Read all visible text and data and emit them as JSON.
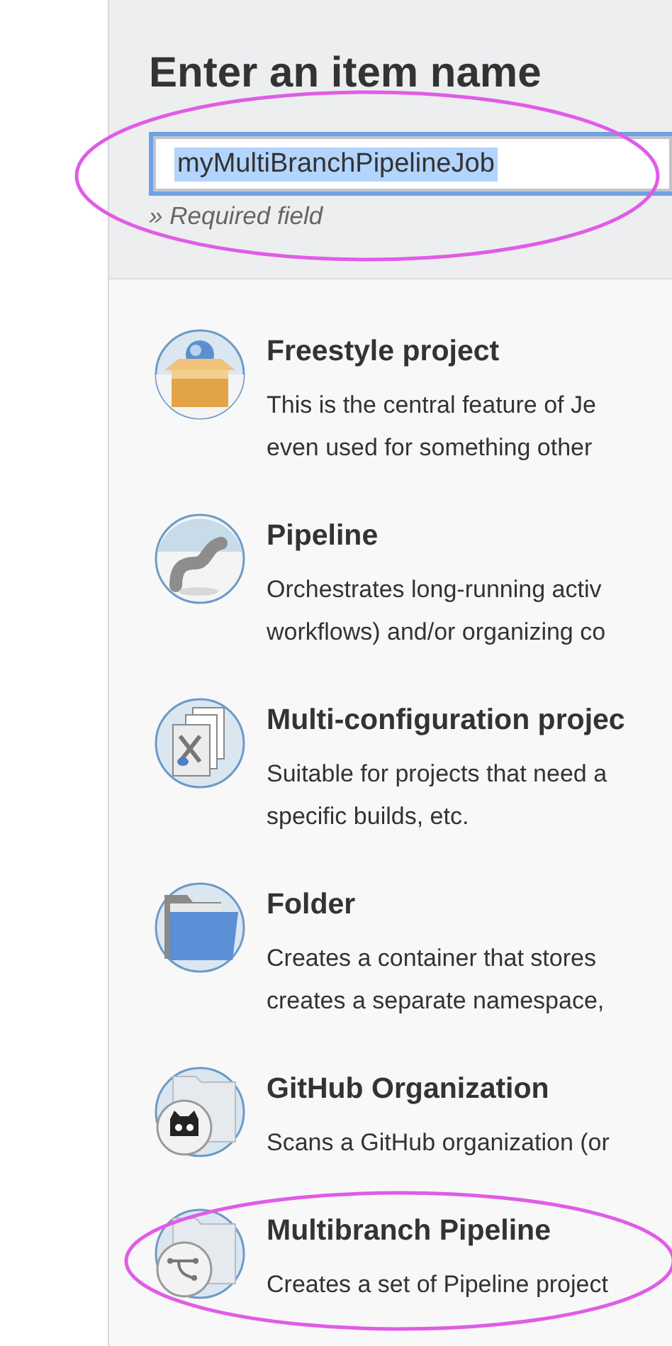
{
  "heading": "Enter an item name",
  "name_field": {
    "value": "myMultiBranchPipelineJob",
    "text_selected": true,
    "circled": true
  },
  "hint": "» Required field",
  "item_types": [
    {
      "kind": "box",
      "title": "Freestyle project",
      "lines": [
        "This is the central feature of Je",
        "even used for something other"
      ],
      "circled": false
    },
    {
      "kind": "pipe",
      "title": "Pipeline",
      "lines": [
        "Orchestrates long-running activ",
        "workflows) and/or organizing co"
      ],
      "circled": false
    },
    {
      "kind": "pages",
      "title": "Multi-configuration projec",
      "lines": [
        "Suitable for projects that need a",
        "specific builds, etc."
      ],
      "circled": false
    },
    {
      "kind": "folder",
      "title": "Folder",
      "lines": [
        "Creates a container that stores",
        "creates a separate namespace,"
      ],
      "circled": false
    },
    {
      "kind": "org",
      "title": "GitHub Organization",
      "lines": [
        "Scans a GitHub organization (or"
      ],
      "circled": false
    },
    {
      "kind": "branch",
      "title": "Multibranch Pipeline",
      "lines": [
        "Creates a set of Pipeline project"
      ],
      "circled": true
    }
  ]
}
